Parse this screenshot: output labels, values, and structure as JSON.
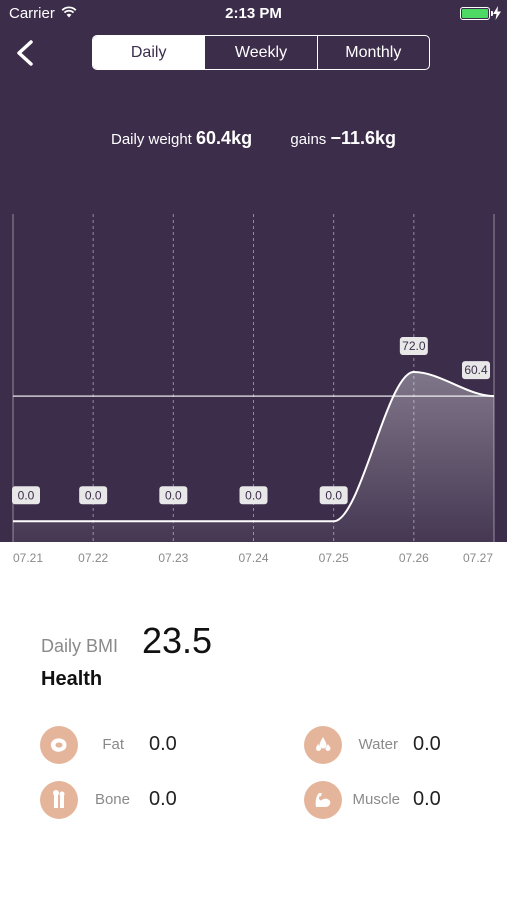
{
  "status_bar": {
    "carrier": "Carrier",
    "time": "2:13 PM",
    "battery_color": "#4cd964"
  },
  "nav": {
    "tabs": [
      "Daily",
      "Weekly",
      "Monthly"
    ],
    "selected_tab": "Daily"
  },
  "summary": {
    "weight_label": "Daily weight",
    "weight_value": "60.4kg",
    "gains_label": "gains",
    "gains_value": "−11.6kg"
  },
  "chart_data": {
    "type": "area",
    "x": [
      "07.21",
      "07.22",
      "07.23",
      "07.24",
      "07.25",
      "07.26",
      "07.27"
    ],
    "values": [
      0.0,
      0.0,
      0.0,
      0.0,
      0.0,
      72.0,
      60.4
    ],
    "labels": [
      "0.0",
      "0.0",
      "0.0",
      "0.0",
      "0.0",
      "72.0",
      "60.4"
    ],
    "reference_line": 60.4,
    "ylim": [
      -10,
      155
    ],
    "colors": {
      "background": "#3c2d4a",
      "line": "#ffffff",
      "label_bg": "#e8e8e8"
    }
  },
  "bmi": {
    "label": "Daily BMI",
    "value": "23.5",
    "status": "Health"
  },
  "metrics": [
    {
      "icon": "fat-icon",
      "label": "Fat",
      "value": "0.0"
    },
    {
      "icon": "water-icon",
      "label": "Water",
      "value": "0.0"
    },
    {
      "icon": "bone-icon",
      "label": "Bone",
      "value": "0.0"
    },
    {
      "icon": "muscle-icon",
      "label": "Muscle",
      "value": "0.0"
    }
  ],
  "accent_color": "#e5b59b"
}
